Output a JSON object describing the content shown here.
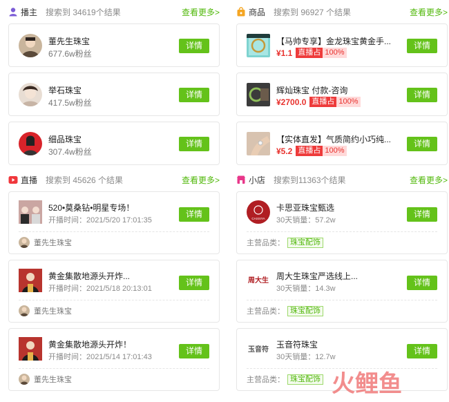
{
  "anchors": {
    "header": {
      "title": "播主",
      "count": "搜索到 34619个结果",
      "more": "查看更多>"
    },
    "items": [
      {
        "name": "董先生珠宝",
        "fans": "677.6w粉丝",
        "btn": "详情"
      },
      {
        "name": "举石珠宝",
        "fans": "417.5w粉丝",
        "btn": "详情"
      },
      {
        "name": "细品珠宝",
        "fans": "307.4w粉丝",
        "btn": "详情"
      }
    ]
  },
  "goods": {
    "header": {
      "title": "商品",
      "count": "搜索到 96927 个结果",
      "more": "查看更多>"
    },
    "items": [
      {
        "title": "【马帅专享】金龙珠宝黄金手...",
        "price": "¥1.1",
        "tag": "直播占",
        "pct": "100%",
        "btn": "详情"
      },
      {
        "title": "辉灿珠宝 付款-咨询",
        "price": "¥2700.0",
        "tag": "直播占",
        "pct": "100%",
        "btn": "详情"
      },
      {
        "title": "【实体直发】气质简约小巧纯...",
        "price": "¥5.2",
        "tag": "直播占",
        "pct": "100%",
        "btn": "详情"
      }
    ]
  },
  "lives": {
    "header": {
      "title": "直播",
      "count": "搜索到 45626 个结果",
      "more": "查看更多>"
    },
    "items": [
      {
        "title": "520•莫桑钻•明星专场！",
        "time": "开播时间：2021/5/20 17:01:35",
        "host": "董先生珠宝",
        "btn": "详情"
      },
      {
        "title": "黄金集散地源头开炸...",
        "time": "开播时间：2021/5/18 20:13:01",
        "host": "董先生珠宝",
        "btn": "详情"
      },
      {
        "title": "黄金集散地源头开炸！",
        "time": "开播时间：2021/5/14 17:01:43",
        "host": "董先生珠宝",
        "btn": "详情"
      }
    ]
  },
  "shops": {
    "header": {
      "title": "小店",
      "count": "搜索到11363个结果",
      "more": "查看更多>"
    },
    "items": [
      {
        "name": "卡思亚珠宝甄选",
        "sales": "30天销量：57.2w",
        "cat_label": "主营品类：",
        "cat": "珠宝配饰",
        "logo": "CASSIYA",
        "btn": "详情"
      },
      {
        "name": "周大生珠宝严选线上...",
        "sales": "30天销量：14.3w",
        "cat_label": "主营品类：",
        "cat": "珠宝配饰",
        "logo": "周大生",
        "btn": "详情"
      },
      {
        "name": "玉音符珠宝",
        "sales": "30天销量：12.7w",
        "cat_label": "主营品类：",
        "cat": "珠宝配饰",
        "logo": "玉音符",
        "btn": "详情"
      }
    ]
  },
  "colors": {
    "accent": "#64c21a",
    "link": "#52b80c",
    "price": "#e8322e"
  },
  "watermark": "火鲤鱼"
}
